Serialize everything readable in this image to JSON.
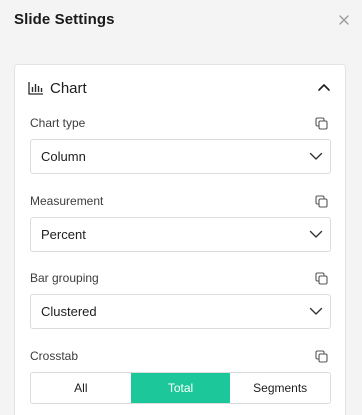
{
  "panel": {
    "title": "Slide Settings"
  },
  "section": {
    "title": "Chart"
  },
  "fields": {
    "chart_type": {
      "label": "Chart type",
      "value": "Column"
    },
    "measurement": {
      "label": "Measurement",
      "value": "Percent"
    },
    "bar_grouping": {
      "label": "Bar grouping",
      "value": "Clustered"
    },
    "crosstab": {
      "label": "Crosstab",
      "options": [
        "All",
        "Total",
        "Segments"
      ],
      "selected": "Total"
    }
  },
  "colors": {
    "accent": "#1cc89a",
    "border": "#dcdcdc",
    "background": "#f4f4f4"
  },
  "icons": {
    "close": "close-icon",
    "chart": "bar-chart-icon",
    "collapse": "chevron-up-icon",
    "dropdown": "chevron-down-icon",
    "copy": "copy-icon"
  }
}
